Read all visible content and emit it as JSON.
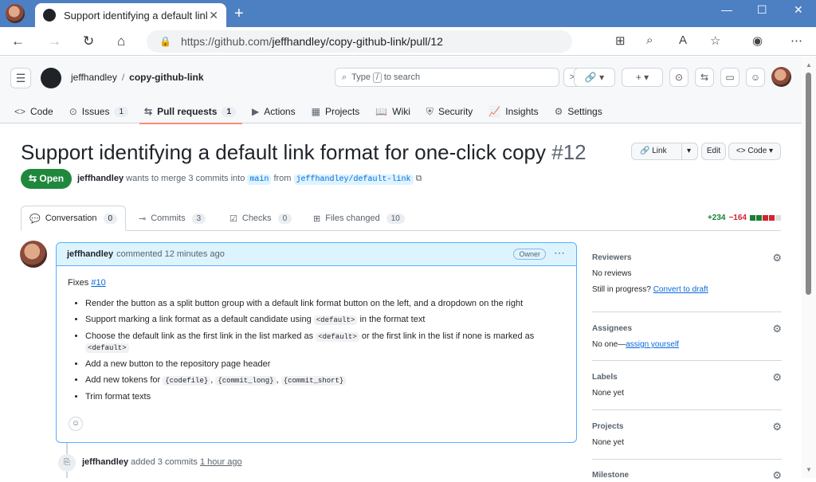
{
  "browser": {
    "tab_title": "Support identifying a default link",
    "url_prefix": "https://github.com/",
    "url_path": "jeffhandley/copy-github-link/pull/12",
    "new_tab_label": "+"
  },
  "header": {
    "owner": "jeffhandley",
    "repo": "copy-github-link",
    "search_prefix": "Type",
    "search_key": "/",
    "search_suffix": "to search"
  },
  "repo_nav": [
    {
      "icon": "<>",
      "label": "Code",
      "count": ""
    },
    {
      "icon": "⊙",
      "label": "Issues",
      "count": "1"
    },
    {
      "icon": "⇆",
      "label": "Pull requests",
      "count": "1"
    },
    {
      "icon": "▶",
      "label": "Actions",
      "count": ""
    },
    {
      "icon": "▦",
      "label": "Projects",
      "count": ""
    },
    {
      "icon": "📖",
      "label": "Wiki",
      "count": ""
    },
    {
      "icon": "⛨",
      "label": "Security",
      "count": ""
    },
    {
      "icon": "📈",
      "label": "Insights",
      "count": ""
    },
    {
      "icon": "⚙",
      "label": "Settings",
      "count": ""
    }
  ],
  "pr": {
    "title": "Support identifying a default link format for one-click copy",
    "number": "#12",
    "state": "Open",
    "author": "jeffhandley",
    "merge_text": "wants to merge 3 commits into",
    "base": "main",
    "from_text": "from",
    "head": "jeffhandley/default-link",
    "link_label": "Link",
    "edit_label": "Edit",
    "code_label": "Code"
  },
  "pr_tabs": [
    {
      "label": "Conversation",
      "count": "0"
    },
    {
      "label": "Commits",
      "count": "3"
    },
    {
      "label": "Checks",
      "count": "0"
    },
    {
      "label": "Files changed",
      "count": "10"
    }
  ],
  "diffstat": {
    "additions": "+234",
    "deletions": "−164"
  },
  "comment": {
    "author": "jeffhandley",
    "action": "commented 12 minutes ago",
    "badge": "Owner",
    "fixes_text": "Fixes",
    "fixes_link": "#10",
    "items": {
      "i1": "Render the button as a split button group with a default link format button on the left, and a dropdown on the right",
      "i2a": "Support marking a link format as a default candidate using",
      "i2code": "<default>",
      "i2b": "in the format text",
      "i3a": "Choose the default link as the first link in the list marked as",
      "i3code": "<default>",
      "i3b": "or the first link in the list if none is marked as",
      "i3code2": "<default>",
      "i4": "Add a new button to the repository page header",
      "i5a": "Add new tokens for",
      "i5c1": "{codefile}",
      "i5c2": "{commit_long}",
      "i5c3": "{commit_short}",
      "i6": "Trim format texts"
    }
  },
  "timeline": {
    "author": "jeffhandley",
    "action": "added 3 commits",
    "time": "1 hour ago"
  },
  "sidebar": {
    "reviewers": {
      "heading": "Reviewers",
      "value": "No reviews",
      "progress": "Still in progress?",
      "link": "Convert to draft"
    },
    "assignees": {
      "heading": "Assignees",
      "value": "No one—",
      "link": "assign yourself"
    },
    "labels": {
      "heading": "Labels",
      "value": "None yet"
    },
    "projects": {
      "heading": "Projects",
      "value": "None yet"
    },
    "milestone": {
      "heading": "Milestone"
    }
  }
}
